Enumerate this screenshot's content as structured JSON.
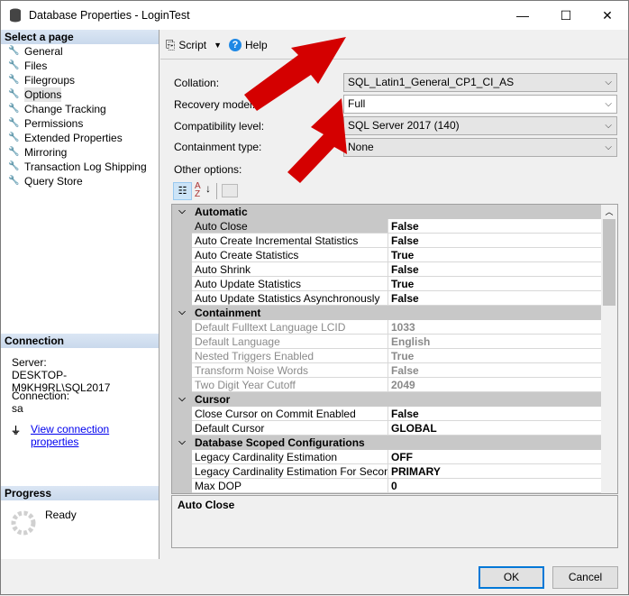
{
  "window": {
    "title": "Database Properties - LoginTest",
    "minimize": "—",
    "maximize": "☐",
    "close": "✕"
  },
  "sidebar": {
    "header": "Select a page",
    "items": [
      {
        "label": "General"
      },
      {
        "label": "Files"
      },
      {
        "label": "Filegroups"
      },
      {
        "label": "Options",
        "selected": true
      },
      {
        "label": "Change Tracking"
      },
      {
        "label": "Permissions"
      },
      {
        "label": "Extended Properties"
      },
      {
        "label": "Mirroring"
      },
      {
        "label": "Transaction Log Shipping"
      },
      {
        "label": "Query Store"
      }
    ]
  },
  "connection": {
    "header": "Connection",
    "server_label": "Server:",
    "server": "DESKTOP-M9KH9RL\\SQL2017",
    "connection_label": "Connection:",
    "connection": "sa",
    "link": "View connection properties"
  },
  "progress": {
    "header": "Progress",
    "status": "Ready"
  },
  "toolbar": {
    "script": "Script",
    "help": "Help"
  },
  "form": {
    "collation": {
      "label": "Collation:",
      "value": "SQL_Latin1_General_CP1_CI_AS"
    },
    "recovery": {
      "label": "Recovery model:",
      "value": "Full"
    },
    "compat": {
      "label": "Compatibility level:",
      "value": "SQL Server 2017 (140)"
    },
    "containment": {
      "label": "Containment type:",
      "value": "None"
    },
    "other": "Other options:"
  },
  "grid": {
    "rows": [
      {
        "cat": "Automatic"
      },
      {
        "name": "Auto Close",
        "value": "False",
        "selected": true
      },
      {
        "name": "Auto Create Incremental Statistics",
        "value": "False"
      },
      {
        "name": "Auto Create Statistics",
        "value": "True"
      },
      {
        "name": "Auto Shrink",
        "value": "False"
      },
      {
        "name": "Auto Update Statistics",
        "value": "True"
      },
      {
        "name": "Auto Update Statistics Asynchronously",
        "value": "False"
      },
      {
        "cat": "Containment"
      },
      {
        "name": "Default Fulltext Language LCID",
        "value": "1033",
        "disabled": true
      },
      {
        "name": "Default Language",
        "value": "English",
        "disabled": true
      },
      {
        "name": "Nested Triggers Enabled",
        "value": "True",
        "disabled": true
      },
      {
        "name": "Transform Noise Words",
        "value": "False",
        "disabled": true
      },
      {
        "name": "Two Digit Year Cutoff",
        "value": "2049",
        "disabled": true
      },
      {
        "cat": "Cursor"
      },
      {
        "name": "Close Cursor on Commit Enabled",
        "value": "False"
      },
      {
        "name": "Default Cursor",
        "value": "GLOBAL"
      },
      {
        "cat": "Database Scoped Configurations"
      },
      {
        "name": "Legacy Cardinality Estimation",
        "value": "OFF"
      },
      {
        "name": "Legacy Cardinality Estimation For Secondary",
        "value": "PRIMARY"
      },
      {
        "name": "Max DOP",
        "value": "0"
      }
    ],
    "description": "Auto Close"
  },
  "buttons": {
    "ok": "OK",
    "cancel": "Cancel"
  },
  "colors": {
    "annotation_arrow": "#d40000",
    "link": "#0000ee",
    "section_header": "#d0deef"
  }
}
